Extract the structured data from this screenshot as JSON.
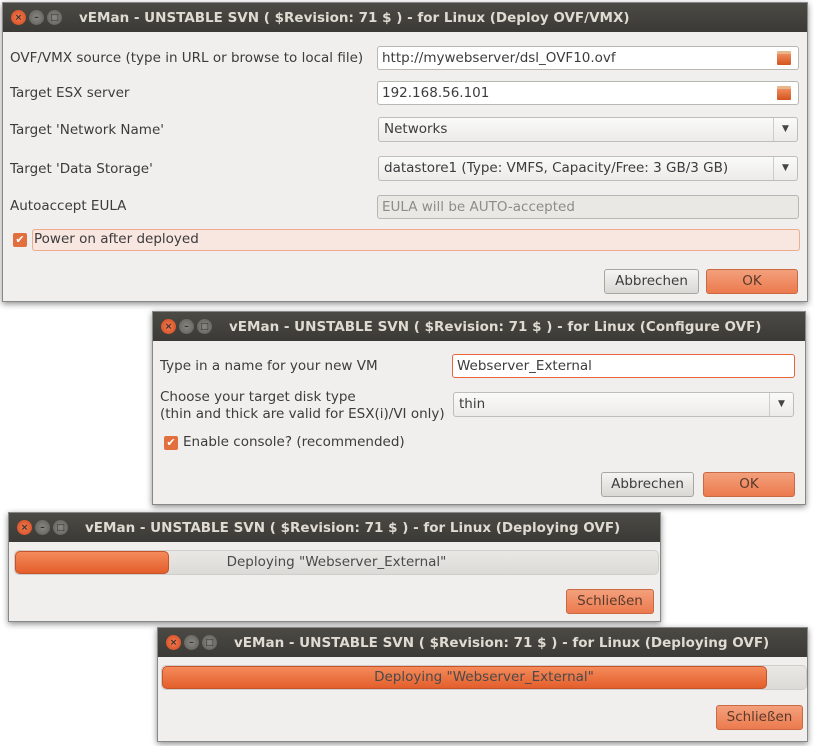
{
  "accent": "#e9643a",
  "deploy_window": {
    "title": "vEMan - UNSTABLE SVN ( $Revision: 71 $ ) - for Linux (Deploy OVF/VMX)",
    "source_label": "OVF/VMX source (type in URL or browse to local file)",
    "source_value": "http://mywebserver/dsl_OVF10.ovf",
    "esx_label": "Target ESX server",
    "esx_value": "192.168.56.101",
    "network_label": "Target 'Network Name'",
    "network_value": "Networks",
    "storage_label": "Target 'Data Storage'",
    "storage_value": "datastore1 (Type: VMFS, Capacity/Free: 3 GB/3 GB)",
    "eula_label": "Autoaccept EULA",
    "eula_value": "EULA will be AUTO-accepted",
    "power_label": "Power on after deployed",
    "power_checked": true,
    "cancel": "Abbrechen",
    "ok": "OK"
  },
  "configure_window": {
    "title": "vEMan - UNSTABLE SVN ( $Revision: 71 $ ) - for Linux (Configure OVF)",
    "name_label": "Type in a name for your new VM",
    "name_value": "Webserver_External",
    "disk_label1": "Choose your target disk type",
    "disk_label2": " (thin and thick are valid for ESX(i)/VI only)",
    "disk_value": "thin",
    "console_label": "Enable console? (recommended)",
    "console_checked": true,
    "cancel": "Abbrechen",
    "ok": "OK"
  },
  "progress_windows": [
    {
      "title": "vEMan - UNSTABLE SVN ( $Revision: 71 $ ) - for Linux (Deploying OVF)",
      "text": "Deploying \"Webserver_External\"",
      "progress": 0.24,
      "close": "Schließen"
    },
    {
      "title": "vEMan - UNSTABLE SVN ( $Revision: 71 $ ) - for Linux (Deploying OVF)",
      "text": "Deploying \"Webserver_External\"",
      "progress": 0.94,
      "close": "Schließen"
    }
  ]
}
